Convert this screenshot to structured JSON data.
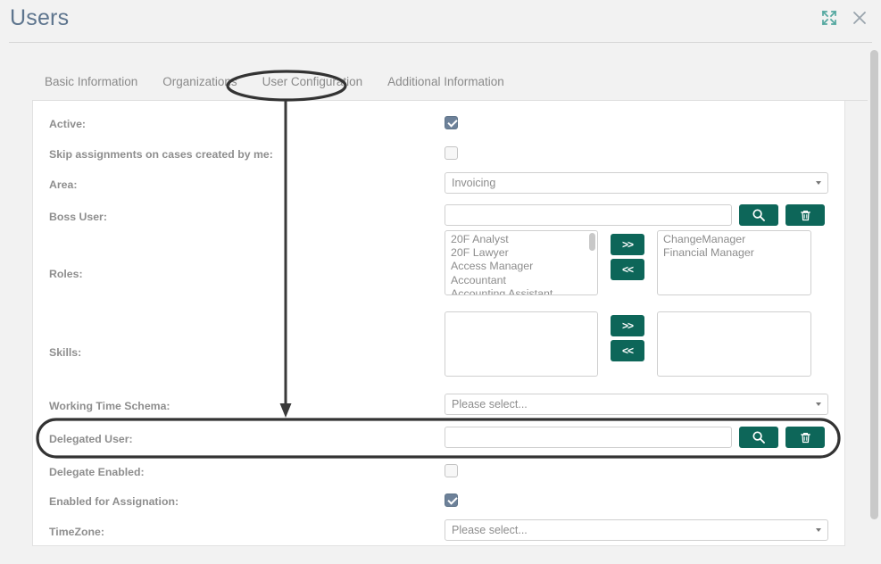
{
  "header": {
    "title": "Users",
    "expand_icon": "expand-icon",
    "close_icon": "close-icon"
  },
  "tabs": [
    {
      "label": "Basic Information",
      "active": false
    },
    {
      "label": "Organizations",
      "active": false
    },
    {
      "label": "User Configuration",
      "active": true
    },
    {
      "label": "Additional Information",
      "active": false
    }
  ],
  "form": {
    "active": {
      "label": "Active:",
      "checked": true
    },
    "skip_assignments": {
      "label": "Skip assignments on cases created by me:",
      "checked": false
    },
    "area": {
      "label": "Area:",
      "value": "Invoicing"
    },
    "boss_user": {
      "label": "Boss User:",
      "value": "",
      "placeholder": ""
    },
    "roles": {
      "label": "Roles:",
      "available": [
        "20F Analyst",
        "20F Lawyer",
        "Access Manager",
        "Accountant",
        "Accounting Assistant"
      ],
      "selected": [
        "ChangeManager",
        "Financial Manager"
      ],
      "add_label": ">>",
      "remove_label": "<<"
    },
    "skills": {
      "label": "Skills:",
      "available": [],
      "selected": [],
      "add_label": ">>",
      "remove_label": "<<"
    },
    "working_time_schema": {
      "label": "Working Time Schema:",
      "value": "Please select..."
    },
    "delegated_user": {
      "label": "Delegated User:",
      "value": "",
      "placeholder": ""
    },
    "delegate_enabled": {
      "label": "Delegate Enabled:",
      "checked": false
    },
    "enabled_for_assignation": {
      "label": "Enabled for Assignation:",
      "checked": true
    },
    "timezone": {
      "label": "TimeZone:",
      "value": "Please select..."
    }
  },
  "buttons": {
    "search_icon": "search-icon",
    "delete_icon": "trash-icon"
  },
  "colors": {
    "teal": "#0d6659",
    "title": "#5e758e",
    "label": "#8e8e8e",
    "checkbox_checked": "#6d8199",
    "page_bg": "#f2f2f2",
    "annotation": "#333333"
  },
  "annotations": {
    "tab_highlight": "User Configuration",
    "row_highlight": "Delegated User:",
    "arrow": "tab-to-delegated-user-arrow"
  }
}
